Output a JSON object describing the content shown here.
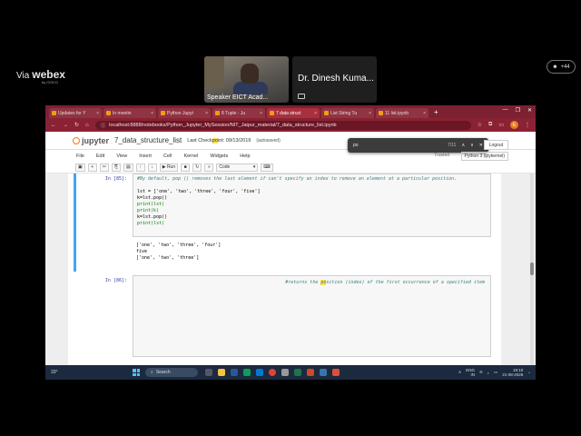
{
  "webex": {
    "via": "Via",
    "brand": "webex",
    "brand_sub": "by CISCO",
    "participants_count": "+44",
    "speaker_label": "Speaker EICT Acad...",
    "host_name": "Dr. Dinesh Kuma..."
  },
  "browser": {
    "tabs": [
      {
        "label": "Updates for Y",
        "active": false
      },
      {
        "label": "In meetin",
        "active": false
      },
      {
        "label": "Python Jupyt",
        "active": false
      },
      {
        "label": "8 Tuple - Ju",
        "active": false
      },
      {
        "label": "7 data struct",
        "active": true
      },
      {
        "label": "List String Tu",
        "active": false
      },
      {
        "label": "11 list.ipynb",
        "active": false
      }
    ],
    "new_tab": "+",
    "url": "localhost:8888/notebooks/Python_Jupyter_MySession/NIT_Jaipur_material/7_data_structure_list.ipynb",
    "profile_initial": "E"
  },
  "find": {
    "query": "po",
    "count": "7/11"
  },
  "jupyter": {
    "logo": "jupyter",
    "notebook_title": "7_data_structure_list",
    "checkpoint_prefix": "Last Check",
    "checkpoint_highlight": "po",
    "checkpoint_suffix": "int: 09/13/2019",
    "autosaved": "(autosaved)",
    "logout": "Logout",
    "menu": [
      "File",
      "Edit",
      "View",
      "Insert",
      "Cell",
      "Kernel",
      "Widgets",
      "Help"
    ],
    "trusted": "Trusted",
    "kernel": "Python 3 (ipykernel)",
    "toolbar": {
      "run": "Run",
      "cell_type": "Code"
    }
  },
  "cells": {
    "cell1": {
      "prompt": "In [85]:",
      "comment": "#By default, pop () removes the last element if can't specify an index to remove an element at a particular position.",
      "line1": "lst = ['one', 'two', 'three', 'four', 'five']",
      "line2": "k=lst.pop()",
      "line3": "print(lst)",
      "line4": "print(k)",
      "line5": "k=lst.pop()",
      "line6": "print(lst)",
      "out1": "['one', 'two', 'three', 'four']",
      "out2": "five",
      "out3": "['one', 'two', 'three']"
    },
    "cell2": {
      "prompt": "In [86]:",
      "comment_before": "#returns the ",
      "comment_highlight": "po",
      "comment_after": "sition (index) of the first occurrence of a specified item"
    }
  },
  "taskbar": {
    "weather": "33°",
    "search": "Search",
    "lang": "ENG",
    "region": "IN",
    "time": "19:10",
    "date": "21-08-2026"
  }
}
